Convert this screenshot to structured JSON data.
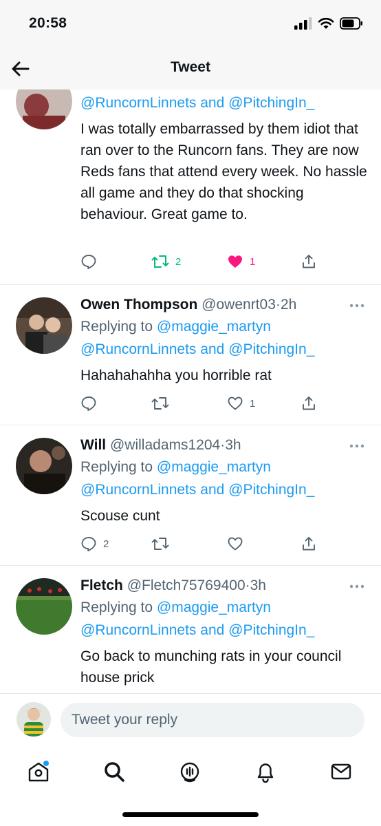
{
  "status_bar": {
    "time": "20:58"
  },
  "nav": {
    "title": "Tweet"
  },
  "tweets": [
    {
      "mention_line": "@RuncornLinnets and @PitchingIn_",
      "body": "I was totally embarrassed by them idiot that ran over to the Runcorn fans. They are now Reds fans that attend every week. No hassle all game and they do that shocking behaviour. Great game to.",
      "retweets": "2",
      "likes": "1",
      "liked": true
    },
    {
      "name": "Owen Thompson",
      "handle": "@owenrt03",
      "dot": "·",
      "time": "2h",
      "replying_prefix": "Replying to",
      "replying_to": "@maggie_martyn",
      "mentions": [
        "@RuncornLinnets",
        "@PitchingIn_"
      ],
      "and_word": "and",
      "body": "Hahahahahha you horrible rat",
      "replies": "",
      "retweets": "",
      "likes": "1"
    },
    {
      "name": "Will",
      "handle": "@willadams1204",
      "dot": "·",
      "time": "3h",
      "replying_prefix": "Replying to",
      "replying_to": "@maggie_martyn",
      "mentions": [
        "@RuncornLinnets",
        "@PitchingIn_"
      ],
      "and_word": "and",
      "body": "Scouse cunt",
      "replies": "2",
      "retweets": "",
      "likes": ""
    },
    {
      "name": "Fletch",
      "handle": "@Fletch75769400",
      "dot": "·",
      "time": "3h",
      "replying_prefix": "Replying to",
      "replying_to": "@maggie_martyn",
      "mentions": [
        "@RuncornLinnets",
        "@PitchingIn_"
      ],
      "and_word": "and",
      "body": "Go back to munching rats in your council house prick"
    }
  ],
  "compose": {
    "placeholder": "Tweet your reply"
  },
  "tab_bar": {
    "items": [
      "home-icon",
      "search-icon",
      "spaces-icon",
      "notifications-icon",
      "messages-icon"
    ],
    "home_has_badge": true
  },
  "colors": {
    "link": "#1d9bf0",
    "muted": "#536471",
    "retweet": "#00ba7c",
    "like": "#f91880",
    "text": "#0f1419"
  }
}
